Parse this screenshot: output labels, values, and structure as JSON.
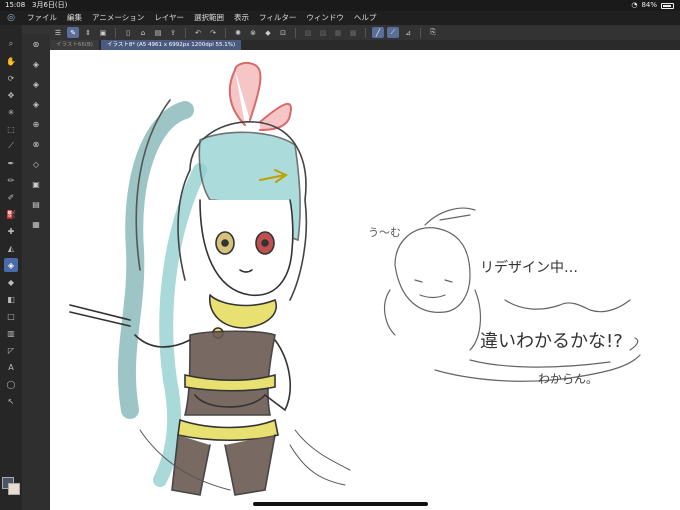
{
  "status": {
    "time": "15:08",
    "date": "3月6日(日)",
    "battery": "84%",
    "battery_level": 0.84
  },
  "menu": [
    "ファイル",
    "編集",
    "アニメーション",
    "レイヤー",
    "選択範囲",
    "表示",
    "フィルター",
    "ウィンドウ",
    "ヘルプ"
  ],
  "tabs": [
    {
      "label": "イラスト66(B)",
      "active": false
    },
    {
      "label": "イラスト8* (A5 4961 x 6992px 1200dpi 55.1%)",
      "active": true
    }
  ],
  "canvas_text": {
    "note1": "う〜む",
    "note2": "リデザイン中…",
    "note3": "違いわかるかな!?",
    "note4": "わからん。"
  },
  "colors": {
    "fg": "#4a5566",
    "bg": "#e8dcd0",
    "accent": "#4a6aa8"
  }
}
